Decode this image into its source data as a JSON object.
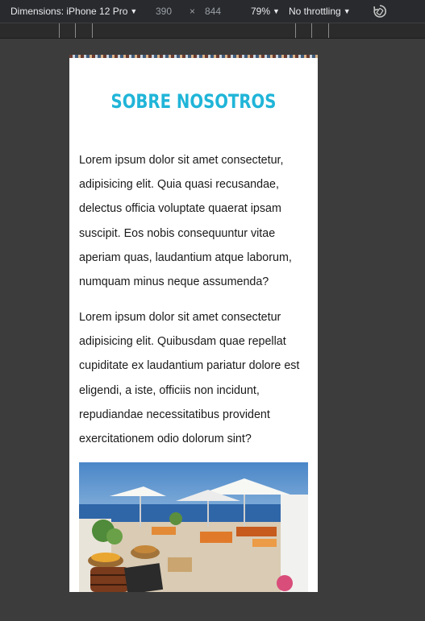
{
  "devtools": {
    "device_label": "Dimensions: iPhone 12 Pro",
    "width": "390",
    "times": "×",
    "height": "844",
    "zoom": "79%",
    "throttle": "No throttling"
  },
  "page": {
    "title": "SOBRE NOSOTROS",
    "paragraph1": "Lorem ipsum dolor sit amet consectetur, adipisicing elit. Quia quasi recusandae, delectus officia voluptate quaerat ipsam suscipit. Eos nobis consequuntur vitae aperiam quas, laudantium atque laborum, numquam minus neque assumenda?",
    "paragraph2": "Lorem ipsum dolor sit amet consectetur adipisicing elit. Quibusdam quae repellat cupiditate ex laudantium pariatur dolore est eligendi, a iste, officiis non incidunt, repudiandae necessitatibus provident exercitationem odio dolorum sint?"
  },
  "colors": {
    "title": "#20b5d8",
    "toolbar_bg": "#292a2d",
    "canvas_bg": "#3c3c3c"
  }
}
